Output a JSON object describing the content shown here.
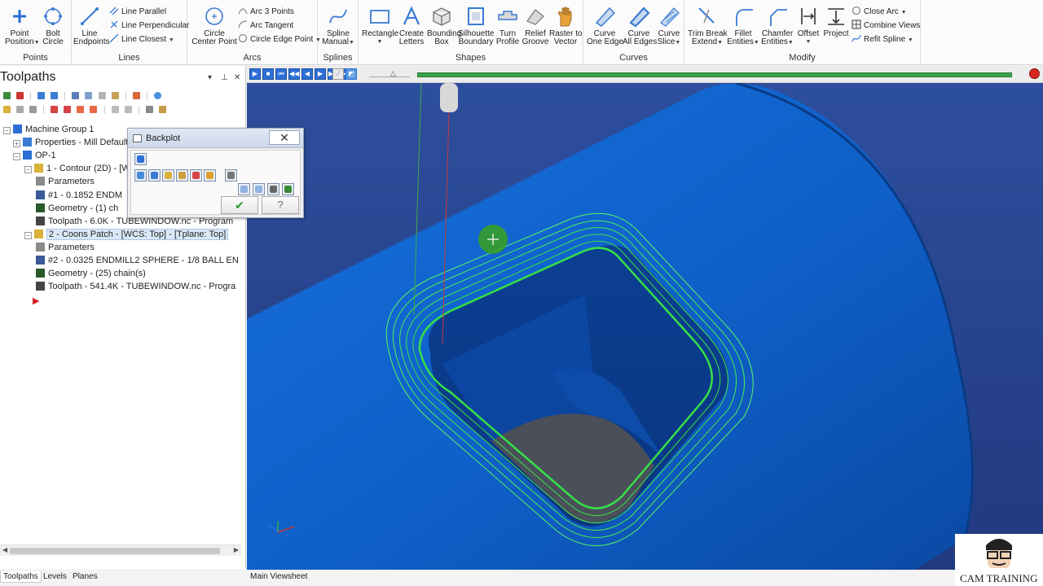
{
  "ribbon": {
    "groups": {
      "points": "Points",
      "lines": "Lines",
      "arcs": "Arcs",
      "splines": "Splines",
      "shapes": "Shapes",
      "curves": "Curves",
      "modify": "Modify"
    },
    "points": {
      "point_position": [
        "Point",
        "Position"
      ],
      "bolt_circle": [
        "Bolt",
        "Circle"
      ]
    },
    "lines": {
      "line_endpoints": [
        "Line",
        "Endpoints"
      ],
      "line_parallel": "Line Parallel",
      "line_perpendicular": "Line Perpendicular",
      "line_closest": "Line Closest"
    },
    "arcs": {
      "circle_center_point": [
        "Circle",
        "Center Point"
      ],
      "arc_3_points": "Arc 3 Points",
      "arc_tangent": "Arc Tangent",
      "circle_edge_point": "Circle Edge Point"
    },
    "splines": {
      "spline_manual": [
        "Spline",
        "Manual"
      ]
    },
    "shapes": {
      "rectangle": "Rectangle",
      "create_letters": [
        "Create",
        "Letters"
      ],
      "bounding_box": [
        "Bounding",
        "Box"
      ],
      "silhouette_boundary": [
        "Silhouette",
        "Boundary"
      ],
      "turn_profile": [
        "Turn",
        "Profile"
      ],
      "relief_groove": [
        "Relief",
        "Groove"
      ],
      "raster_to_vector": [
        "Raster to",
        "Vector"
      ]
    },
    "curves": {
      "curve_one_edge": [
        "Curve",
        "One Edge"
      ],
      "curve_all_edges": [
        "Curve",
        "All Edges"
      ],
      "curve_slice": [
        "Curve",
        "Slice"
      ]
    },
    "modify": {
      "trim_break_extend": [
        "Trim Break",
        "Extend"
      ],
      "fillet_entities": [
        "Fillet",
        "Entities"
      ],
      "chamfer_entities": [
        "Chamfer",
        "Entities"
      ],
      "offset": "Offset",
      "project": "Project",
      "close_arc": "Close Arc",
      "combine_views": "Combine Views",
      "refit_spline": "Refit Spline"
    }
  },
  "panel": {
    "title": "Toolpaths",
    "pin": "▾",
    "pushpin": "⊥",
    "close": "✕"
  },
  "tree": [
    {
      "text": "Machine Group 1",
      "level": 0,
      "expander": "−",
      "icon": "machine-group-icon"
    },
    {
      "text": "Properties - Mill Default",
      "level": 1,
      "expander": "+",
      "icon": "properties-icon"
    },
    {
      "text": "OP-1",
      "level": 1,
      "expander": "−",
      "icon": "operation-group-icon"
    },
    {
      "text": "1 - Contour (2D) - [W",
      "level": 2,
      "expander": "−",
      "icon": "folder-icon"
    },
    {
      "text": "Parameters",
      "level": 3,
      "expander": "",
      "icon": "parameters-icon"
    },
    {
      "text": "#1 - 0.1852 ENDM",
      "level": 3,
      "expander": "",
      "icon": "tool-icon"
    },
    {
      "text": "Geometry -  (1) ch",
      "level": 3,
      "expander": "",
      "icon": "geometry-icon"
    },
    {
      "text": "Toolpath - 6.0K - TUBEWINDOW.nc - Program",
      "level": 3,
      "expander": "",
      "icon": "toolpath-icon"
    },
    {
      "text": "2 - Coons Patch - [WCS: Top] - [Tplane: Top]",
      "level": 2,
      "expander": "−",
      "icon": "folder-icon",
      "highlight": true
    },
    {
      "text": "Parameters",
      "level": 3,
      "expander": "",
      "icon": "parameters-icon"
    },
    {
      "text": "#2 - 0.0325 ENDMILL2 SPHERE -  1/8 BALL EN",
      "level": 3,
      "expander": "",
      "icon": "tool-icon"
    },
    {
      "text": "Geometry -  (25) chain(s)",
      "level": 3,
      "expander": "",
      "icon": "geometry-icon"
    },
    {
      "text": "Toolpath - 541.4K - TUBEWINDOW.nc - Progra",
      "level": 3,
      "expander": "",
      "icon": "toolpath-icon"
    }
  ],
  "bottom_tabs": {
    "toolpaths": "Toolpaths",
    "levels": "Levels",
    "planes": "Planes"
  },
  "viewport": {
    "tab": "Main Viewsheet",
    "playback": [
      "▶",
      "■",
      "⏮",
      "◀◀",
      "◀",
      "▶",
      "▶▶",
      "⏭"
    ],
    "progress": 1.0
  },
  "backplot": {
    "title": "Backplot",
    "close": "✕",
    "ok": "✔",
    "help": "?"
  },
  "logo": {
    "text": "CAM TRAINING"
  },
  "colors": {
    "accent": "#2d6fd6",
    "part": "#0f63cf",
    "toolpath": "#33ee44",
    "progress": "#3aa24a"
  }
}
